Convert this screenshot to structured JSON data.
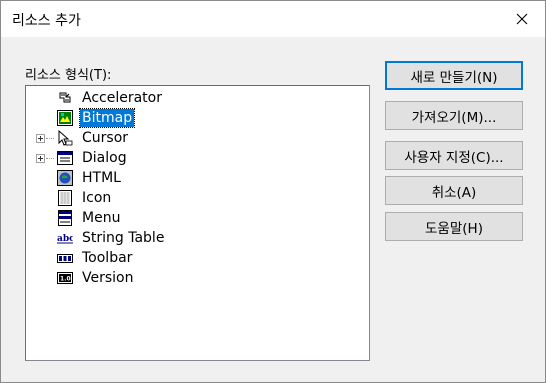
{
  "window": {
    "title": "리소스 추가"
  },
  "resource_list": {
    "label": "리소스 형식(T):",
    "items": [
      {
        "label": "Accelerator",
        "icon": "accelerator-icon",
        "expandable": false,
        "selected": false
      },
      {
        "label": "Bitmap",
        "icon": "bitmap-icon",
        "expandable": false,
        "selected": true
      },
      {
        "label": "Cursor",
        "icon": "cursor-icon",
        "expandable": true,
        "selected": false
      },
      {
        "label": "Dialog",
        "icon": "dialog-icon",
        "expandable": true,
        "selected": false
      },
      {
        "label": "HTML",
        "icon": "html-icon",
        "expandable": false,
        "selected": false
      },
      {
        "label": "Icon",
        "icon": "icon-resource-icon",
        "expandable": false,
        "selected": false
      },
      {
        "label": "Menu",
        "icon": "menu-icon",
        "expandable": false,
        "selected": false
      },
      {
        "label": "String Table",
        "icon": "string-table-icon",
        "expandable": false,
        "selected": false
      },
      {
        "label": "Toolbar",
        "icon": "toolbar-icon",
        "expandable": false,
        "selected": false
      },
      {
        "label": "Version",
        "icon": "version-icon",
        "expandable": false,
        "selected": false
      }
    ]
  },
  "buttons": {
    "new": "새로 만들기(N)",
    "import": "가져오기(M)...",
    "custom": "사용자 지정(C)...",
    "cancel": "취소(A)",
    "help": "도움말(H)"
  },
  "colors": {
    "selection": "#0078d7",
    "default_button_border": "#0078d7",
    "dialog_background": "#f0f0f0"
  }
}
